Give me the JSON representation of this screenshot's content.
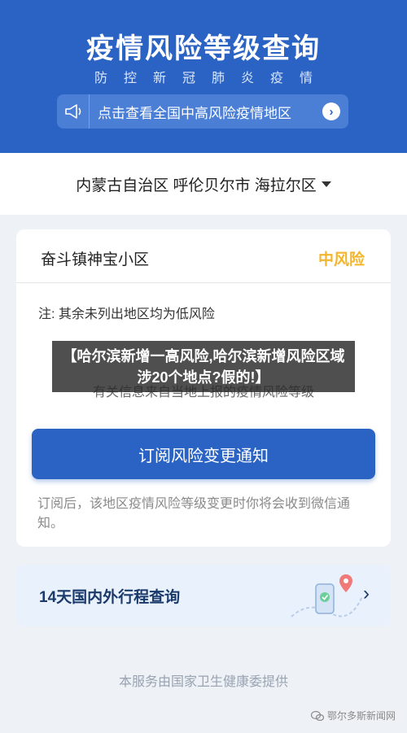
{
  "header": {
    "title": "疫情风险等级查询",
    "subtitle": "防控新冠肺炎疫情",
    "notice": "点击查看全国中高风险疫情地区",
    "notice_icon": "megaphone-icon",
    "arrow_glyph": "›"
  },
  "region": {
    "selected": "内蒙古自治区 呼伦贝尔市 海拉尔区"
  },
  "result": {
    "community": "奋斗镇神宝小区",
    "risk": "中风险",
    "note": "注: 其余未列出地区均为低风险",
    "info_line": "有关信息来自当地上报的疫情风险等级"
  },
  "subscribe": {
    "button": "订阅风险变更通知",
    "description": "订阅后，该地区疫情风险等级变更时你将会收到微信通知。"
  },
  "trip": {
    "label": "14天国内外行程查询",
    "arrow_glyph": "›"
  },
  "footer": {
    "provider": "本服务由国家卫生健康委提供"
  },
  "watermark": {
    "text": "鄂尔多斯新闻网"
  },
  "overlay": {
    "headline": "【哈尔滨新增一高风险,哈尔滨新增风险区域涉20个地点?假的!】"
  },
  "colors": {
    "primary": "#2a63c4",
    "medium_risk": "#f2b52c",
    "background": "#eef1f6"
  }
}
